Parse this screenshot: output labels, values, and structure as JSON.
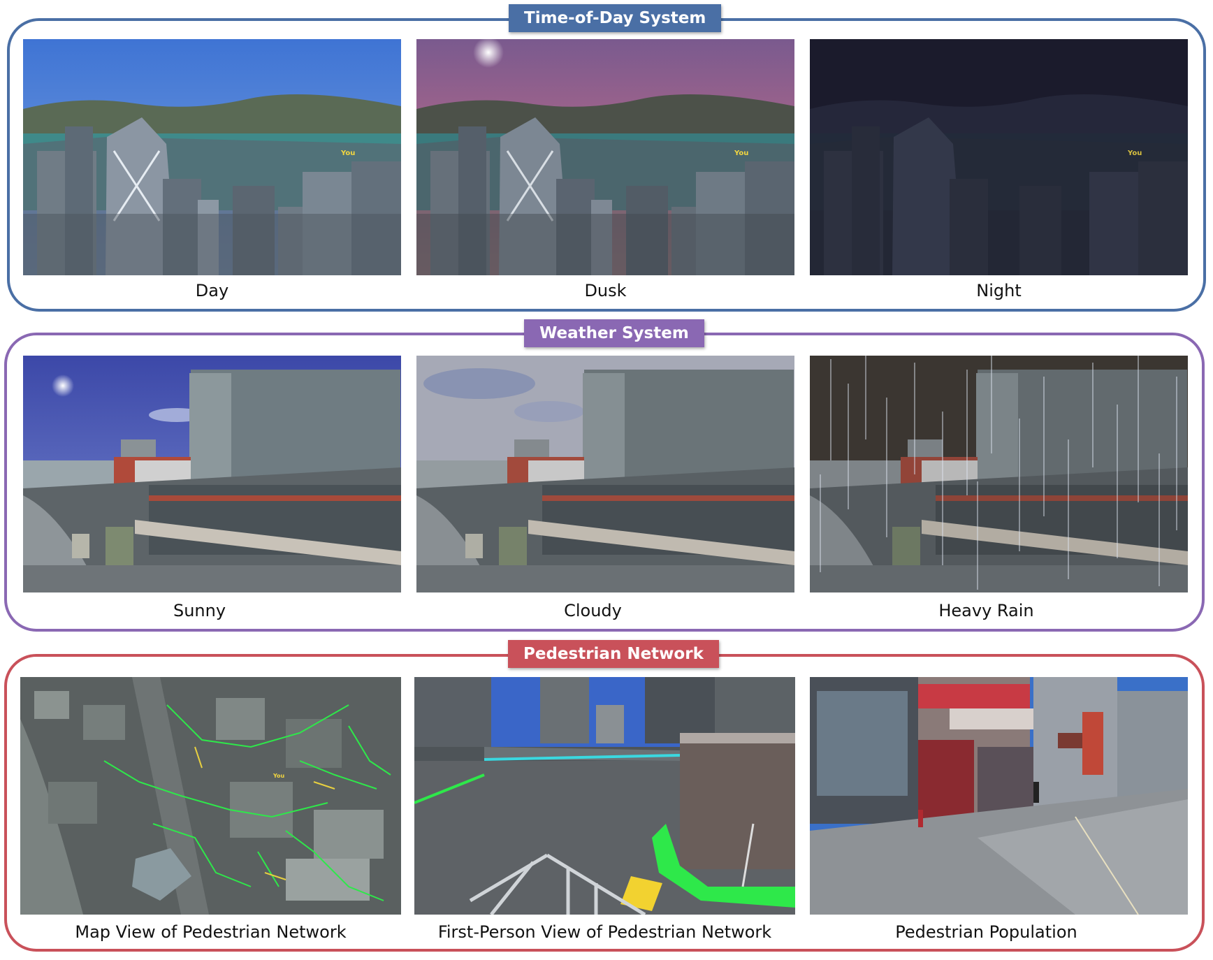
{
  "sections": [
    {
      "title": "Time-of-Day System",
      "color": "#4a6fa5",
      "panels": [
        {
          "caption": "Day",
          "marker": "You"
        },
        {
          "caption": "Dusk",
          "marker": "You"
        },
        {
          "caption": "Night",
          "marker": "You"
        }
      ]
    },
    {
      "title": "Weather System",
      "color": "#8a68b3",
      "panels": [
        {
          "caption": "Sunny"
        },
        {
          "caption": "Cloudy"
        },
        {
          "caption": "Heavy Rain"
        }
      ]
    },
    {
      "title": "Pedestrian Network",
      "color": "#c9515a",
      "panels": [
        {
          "caption": "Map View of Pedestrian Network",
          "marker": "You"
        },
        {
          "caption": "First-Person View of Pedestrian Network"
        },
        {
          "caption": "Pedestrian Population"
        }
      ]
    }
  ]
}
